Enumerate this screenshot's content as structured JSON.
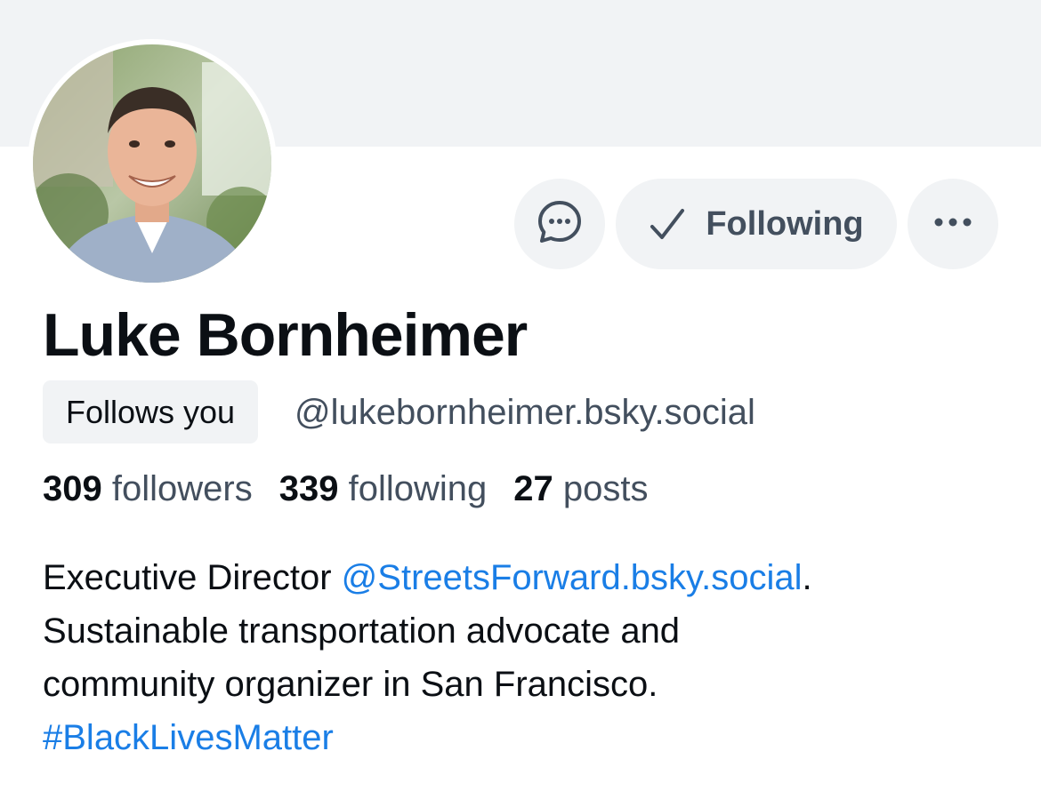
{
  "profile": {
    "display_name": "Luke Bornheimer",
    "follows_you": "Follows you",
    "handle": "@lukebornheimer.bsky.social",
    "avatar_icon": "profile-photo"
  },
  "actions": {
    "message_icon": "chat-bubble-icon",
    "following_label": "Following",
    "more_icon": "ellipsis-icon"
  },
  "stats": {
    "followers_count": "309",
    "followers_label": "followers",
    "following_count": "339",
    "following_label": "following",
    "posts_count": "27",
    "posts_label": "posts"
  },
  "bio": {
    "line1_text": "Executive Director ",
    "line1_mention": "@StreetsForward.bsky.social",
    "line1_end": ".",
    "line2": "Sustainable transportation advocate and",
    "line3": "community organizer in San Francisco.",
    "hashtag": "#BlackLivesMatter"
  },
  "colors": {
    "link": "#1a7ee6",
    "muted_text": "#434f5e",
    "button_bg": "#f1f3f5",
    "primary_text": "#0b0f14"
  }
}
